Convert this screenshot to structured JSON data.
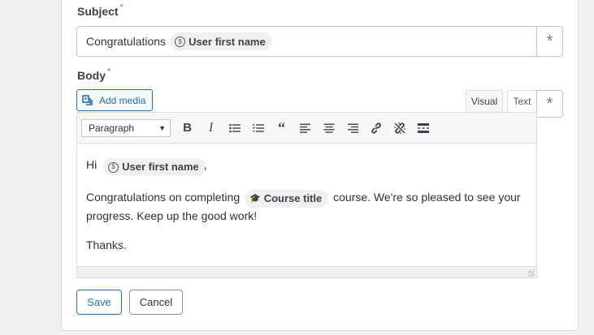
{
  "subject": {
    "label": "Subject",
    "required_mark": "*",
    "text": "Congratulations",
    "tag_label": "User first name"
  },
  "body": {
    "label": "Body",
    "required_mark": "*",
    "add_media_label": "Add media",
    "tabs": [
      {
        "label": "Visual",
        "active": true
      },
      {
        "label": "Text",
        "active": false
      }
    ],
    "format_select": "Paragraph",
    "content": {
      "line1_prefix": "Hi",
      "line1_tag": "User first name",
      "line1_suffix": ",",
      "line2_prefix": "Congratulations on completing",
      "line2_tag": "Course title",
      "line2_suffix": "course. We're so pleased to see your progress. Keep up the good work!",
      "line3": "Thanks."
    }
  },
  "insert_symbol": "*",
  "actions": {
    "save_label": "Save",
    "cancel_label": "Cancel"
  },
  "colors": {
    "accent": "#2271b1",
    "required": "#d63638"
  },
  "icons": [
    "user-tag-icon",
    "add-media-icon",
    "bold-icon",
    "italic-icon",
    "bulleted-list-icon",
    "numbered-list-icon",
    "blockquote-icon",
    "align-left-icon",
    "align-center-icon",
    "align-right-icon",
    "link-icon",
    "unlink-icon",
    "read-more-icon",
    "course-cap-icon",
    "resize-grip-icon"
  ]
}
